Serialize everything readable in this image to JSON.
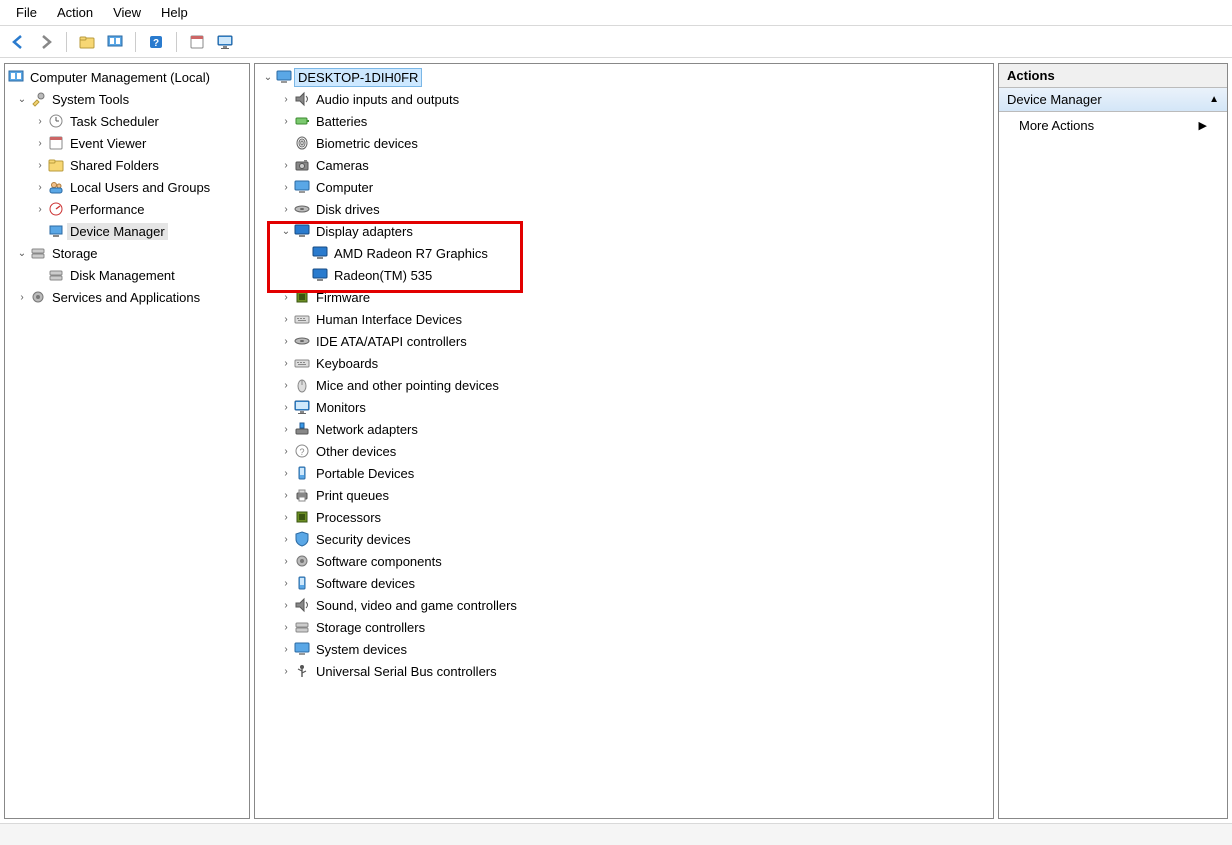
{
  "menu": {
    "file": "File",
    "action": "Action",
    "view": "View",
    "help": "Help"
  },
  "left_tree": {
    "root": "Computer Management (Local)",
    "system_tools": "System Tools",
    "task_scheduler": "Task Scheduler",
    "event_viewer": "Event Viewer",
    "shared_folders": "Shared Folders",
    "local_users": "Local Users and Groups",
    "performance": "Performance",
    "device_manager": "Device Manager",
    "storage": "Storage",
    "disk_management": "Disk Management",
    "services_apps": "Services and Applications"
  },
  "center_tree": {
    "root": "DESKTOP-1DIH0FR",
    "audio": "Audio inputs and outputs",
    "batteries": "Batteries",
    "biometric": "Biometric devices",
    "cameras": "Cameras",
    "computer": "Computer",
    "disk_drives": "Disk drives",
    "display_adapters": "Display adapters",
    "amd_radeon": "AMD Radeon R7 Graphics",
    "radeon_535": "Radeon(TM) 535",
    "firmware": "Firmware",
    "hid": "Human Interface Devices",
    "ide": "IDE ATA/ATAPI controllers",
    "keyboards": "Keyboards",
    "mice": "Mice and other pointing devices",
    "monitors": "Monitors",
    "network": "Network adapters",
    "other": "Other devices",
    "portable": "Portable Devices",
    "print_queues": "Print queues",
    "processors": "Processors",
    "security": "Security devices",
    "sw_components": "Software components",
    "sw_devices": "Software devices",
    "sound": "Sound, video and game controllers",
    "storage_ctrl": "Storage controllers",
    "system_devices": "System devices",
    "usb": "Universal Serial Bus controllers"
  },
  "actions": {
    "title": "Actions",
    "section": "Device Manager",
    "more": "More Actions"
  }
}
